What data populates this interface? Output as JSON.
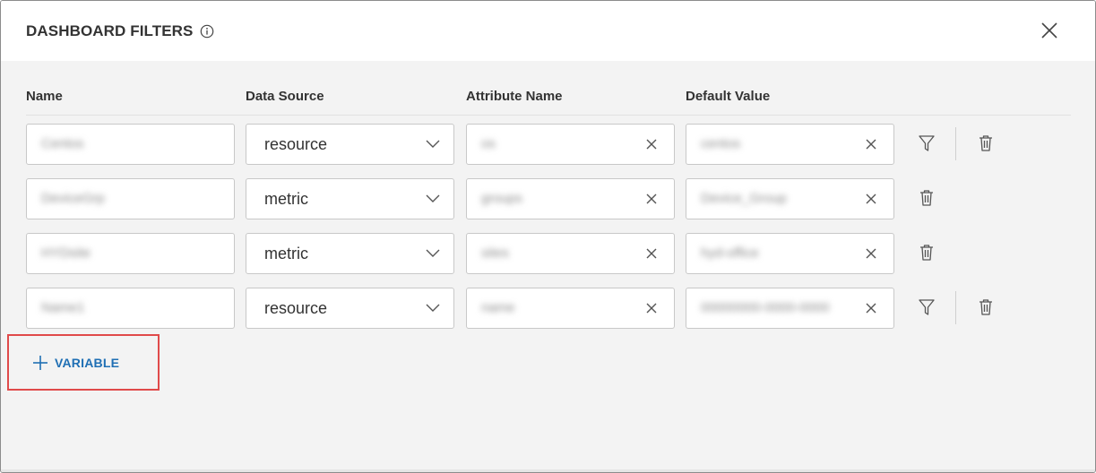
{
  "dialog": {
    "title": "DASHBOARD FILTERS",
    "info_icon": "info-icon",
    "close_icon": "close-icon"
  },
  "columns": {
    "name": "Name",
    "data_source": "Data Source",
    "attribute_name": "Attribute Name",
    "default_value": "Default Value"
  },
  "rows": [
    {
      "name": "Centos",
      "data_source": "resource",
      "attribute": "os",
      "default_value": "centos",
      "has_filter": true
    },
    {
      "name": "DeviceGrp",
      "data_source": "metric",
      "attribute": "groups",
      "default_value": "Device_Group",
      "has_filter": false
    },
    {
      "name": "HYDsite",
      "data_source": "metric",
      "attribute": "sites",
      "default_value": "hyd-office",
      "has_filter": false
    },
    {
      "name": "Name1",
      "data_source": "resource",
      "attribute": "name",
      "default_value": "00000000-0000-0000",
      "has_filter": true
    }
  ],
  "add_variable": {
    "label": "VARIABLE"
  },
  "colors": {
    "accent": "#1f6fb4",
    "highlight": "#e04a4a",
    "panel_bg": "#f3f3f3"
  }
}
